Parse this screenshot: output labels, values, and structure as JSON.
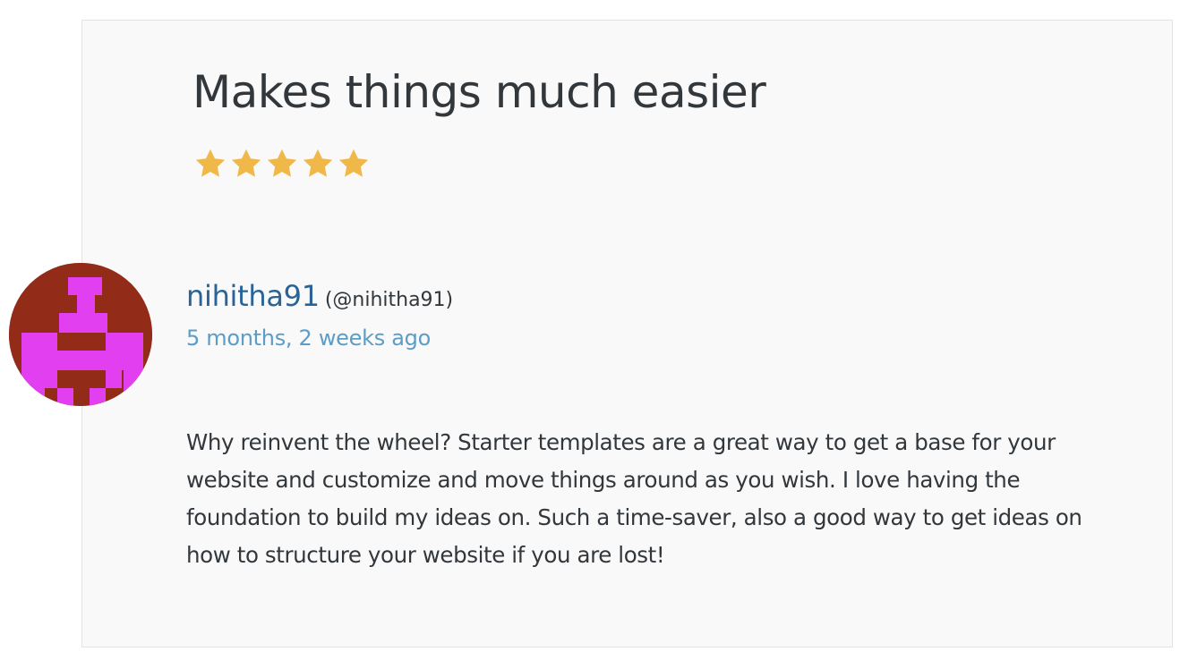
{
  "review": {
    "title": "Makes things much easier",
    "rating": 5,
    "rating_max": 5,
    "reviewer": {
      "name": "nihitha91",
      "handle": "(@nihitha91)",
      "avatar_icon": "identicon-avatar"
    },
    "date": "5 months, 2 weeks ago",
    "body": "Why reinvent the wheel? Starter templates are a great way to get a base for your website and customize and move things around as you wish. I love having the foundation to build my ideas on. Such a time-saver, also a good way to get ideas on how to structure your website if you are lost!"
  },
  "colors": {
    "star": "#f0b849",
    "avatar_background": "#932b19",
    "avatar_foreground": "#e23ff0",
    "link": "#2a6496",
    "date": "#5b9dc6",
    "text": "#32373c"
  }
}
